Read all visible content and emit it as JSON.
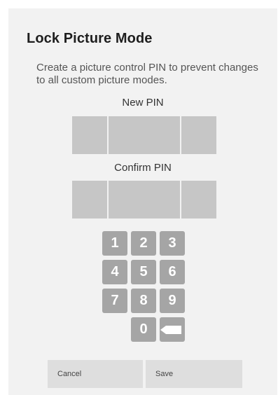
{
  "dialog": {
    "title": "Lock Picture Mode",
    "description": "Create a picture control PIN to prevent changes to all custom picture modes.",
    "new_pin_label": "New PIN",
    "confirm_pin_label": "Confirm PIN"
  },
  "keypad": {
    "keys": [
      "1",
      "2",
      "3",
      "4",
      "5",
      "6",
      "7",
      "8",
      "9",
      "0"
    ],
    "backspace_icon": "backspace-icon"
  },
  "buttons": {
    "cancel_label": "Cancel",
    "save_label": "Save"
  },
  "colors": {
    "dialog_background": "#f2f2f2",
    "pin_box": "#c6c6c6",
    "key_background": "#a5a5a5",
    "button_background": "#dedede"
  }
}
